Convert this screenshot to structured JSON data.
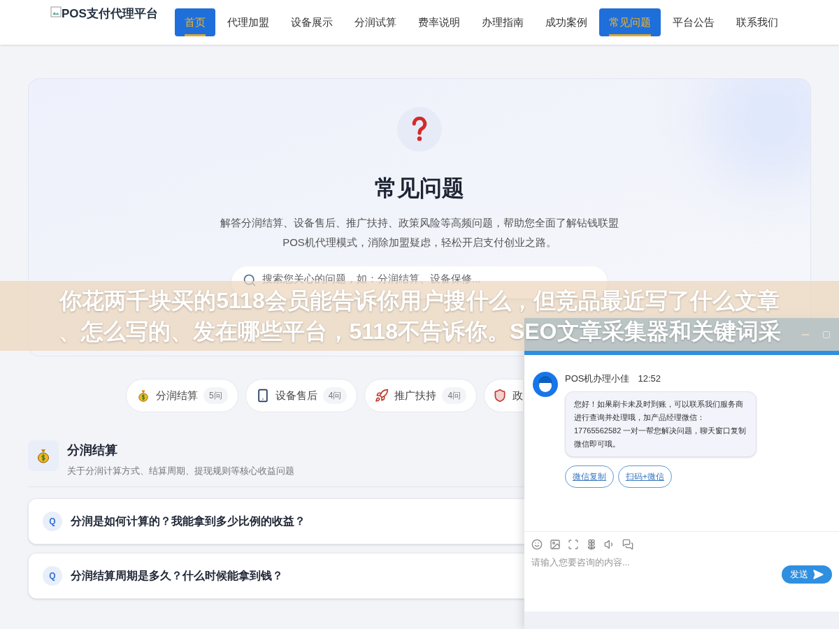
{
  "header": {
    "logo": "POS支付代理平台",
    "nav": [
      {
        "label": "首页",
        "selected": true
      },
      {
        "label": "代理加盟",
        "selected": false
      },
      {
        "label": "设备展示",
        "selected": false
      },
      {
        "label": "分润试算",
        "selected": false
      },
      {
        "label": "费率说明",
        "selected": false
      },
      {
        "label": "办理指南",
        "selected": false
      },
      {
        "label": "成功案例",
        "selected": false
      },
      {
        "label": "常见问题",
        "selected": true
      },
      {
        "label": "平台公告",
        "selected": false
      },
      {
        "label": "联系我们",
        "selected": false
      }
    ]
  },
  "hero": {
    "title": "常见问题",
    "description": "解答分润结算、设备售后、推广扶持、政策风险等高频问题，帮助您全面了解钻钱联盟POS机代理模式，消除加盟疑虑，轻松开启支付创业之路。",
    "search": {
      "placeholder": "搜索您关心的问题，如：分润结算、设备保修..."
    }
  },
  "categories": [
    {
      "label": "分润结算",
      "count": "5问"
    },
    {
      "label": "设备售后",
      "count": "4问"
    },
    {
      "label": "推广扶持",
      "count": "4问"
    },
    {
      "label": "政"
    }
  ],
  "section": {
    "title": "分润结算",
    "subtitle": "关于分润计算方式、结算周期、提现规则等核心收益问题"
  },
  "faqs": [
    {
      "badge": "Q",
      "question": "分润是如何计算的？我能拿到多少比例的收益？"
    },
    {
      "badge": "Q",
      "question": "分润结算周期是多久？什么时候能拿到钱？"
    }
  ],
  "banner": {
    "lines": [
      "你花两千块买的5118会员能告诉你用户搜什么，但竞品最近写了什么文章",
      "、怎么写的、发在哪些平台，5118不告诉你。SEO文章采集器和关键词采"
    ]
  },
  "chat": {
    "agent": "POS机办理小佳",
    "time": "12:52",
    "message": "您好！如果刷卡未及时到账，可以联系我们服务商进行查询并处理哦，加产品经理微信：17765562582 一对一帮您解决问题，聊天窗口复制微信即可哦。",
    "actions": [
      "微信复制",
      "扫码+微信"
    ],
    "input": {
      "placeholder": "请输入您要咨询的内容..."
    },
    "send": "发送"
  }
}
